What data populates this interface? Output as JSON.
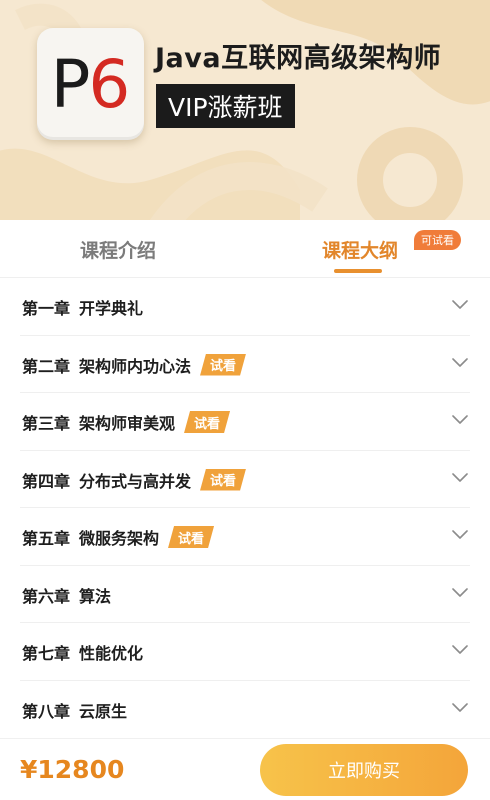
{
  "banner": {
    "logo_p": "P",
    "logo_6": "6",
    "title": "Java互联网高级架构师",
    "subtitle": "VIP涨薪班"
  },
  "tabs": [
    {
      "label": "课程介绍",
      "active": false
    },
    {
      "label": "课程大纲",
      "active": true
    }
  ],
  "tab_badge": "可试看",
  "chapters": [
    {
      "num": "第一章",
      "title": "开学典礼",
      "trial": ""
    },
    {
      "num": "第二章",
      "title": "架构师内功心法",
      "trial": "试看"
    },
    {
      "num": "第三章",
      "title": "架构师审美观",
      "trial": "试看"
    },
    {
      "num": "第四章",
      "title": "分布式与高并发",
      "trial": "试看"
    },
    {
      "num": "第五章",
      "title": "微服务架构",
      "trial": "试看"
    },
    {
      "num": "第六章",
      "title": "算法",
      "trial": ""
    },
    {
      "num": "第七章",
      "title": "性能优化",
      "trial": ""
    },
    {
      "num": "第八章",
      "title": "云原生",
      "trial": ""
    }
  ],
  "footer": {
    "price": "¥12800",
    "buy_label": "立即购买"
  },
  "colors": {
    "accent": "#e8902f",
    "badge": "#f07c3a",
    "trial_tag": "#f0a23b",
    "banner_bg": "#f6e8d1"
  }
}
